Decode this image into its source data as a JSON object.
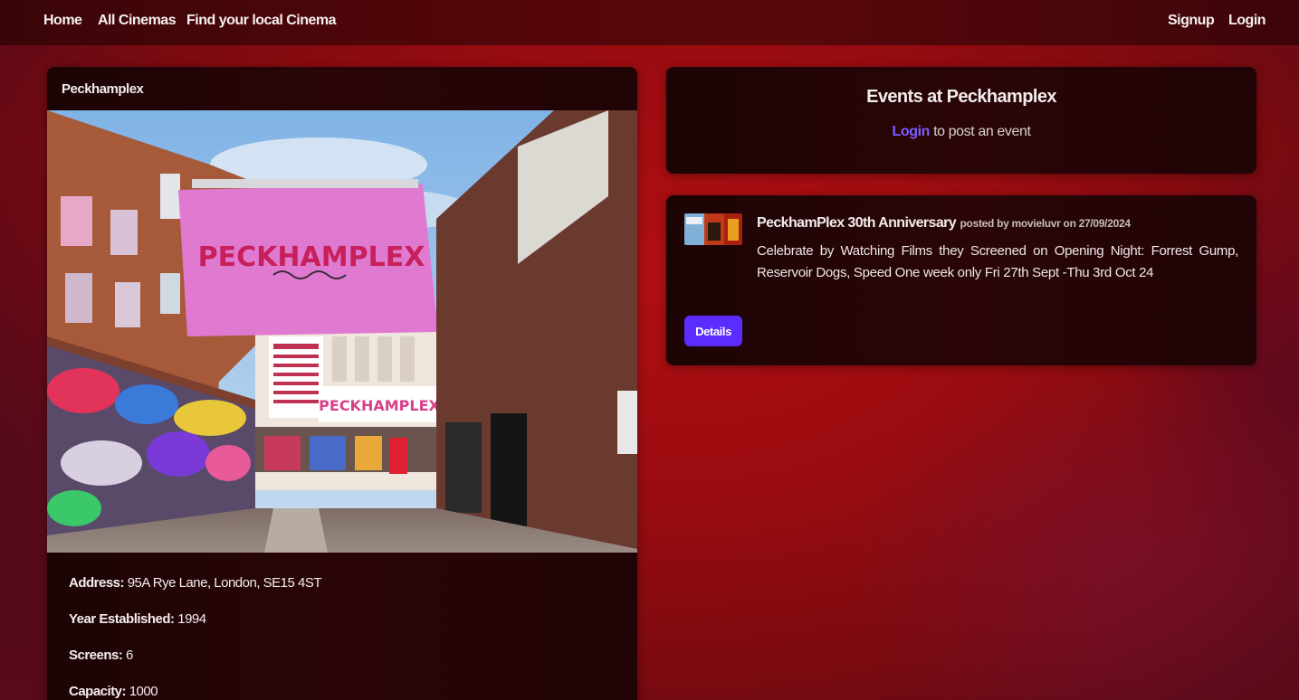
{
  "nav": {
    "left": [
      "Home",
      "All Cinemas",
      "Find your local Cinema"
    ],
    "right": [
      "Signup",
      "Login"
    ]
  },
  "cinema": {
    "name": "Peckhamplex",
    "photo_sign_text": "PECKHAMPLEX",
    "info": {
      "address_label": "Address:",
      "address": "95A Rye Lane, London, SE15 4ST",
      "year_label": "Year Established:",
      "year": "1994",
      "screens_label": "Screens:",
      "screens": "6",
      "capacity_label": "Capacity:",
      "capacity": "1000"
    }
  },
  "events_panel": {
    "title": "Events at Peckhamplex",
    "login_link": "Login",
    "login_suffix": "to post an event"
  },
  "event": {
    "title": "PeckhamPlex 30th Anniversary",
    "meta": "posted by movieluvr on 27/09/2024",
    "description": "Celebrate by Watching Films they Screened on Opening Night: Forrest Gump, Reservoir Dogs, Speed One week only Fri 27th Sept -Thu 3rd Oct 24",
    "details_button": "Details"
  },
  "colors": {
    "nav_bg": "#4a0608",
    "card_bg": "#240506",
    "accent_button": "#5a2cff",
    "link": "#7b5cff",
    "page_red": "#a50e12"
  }
}
